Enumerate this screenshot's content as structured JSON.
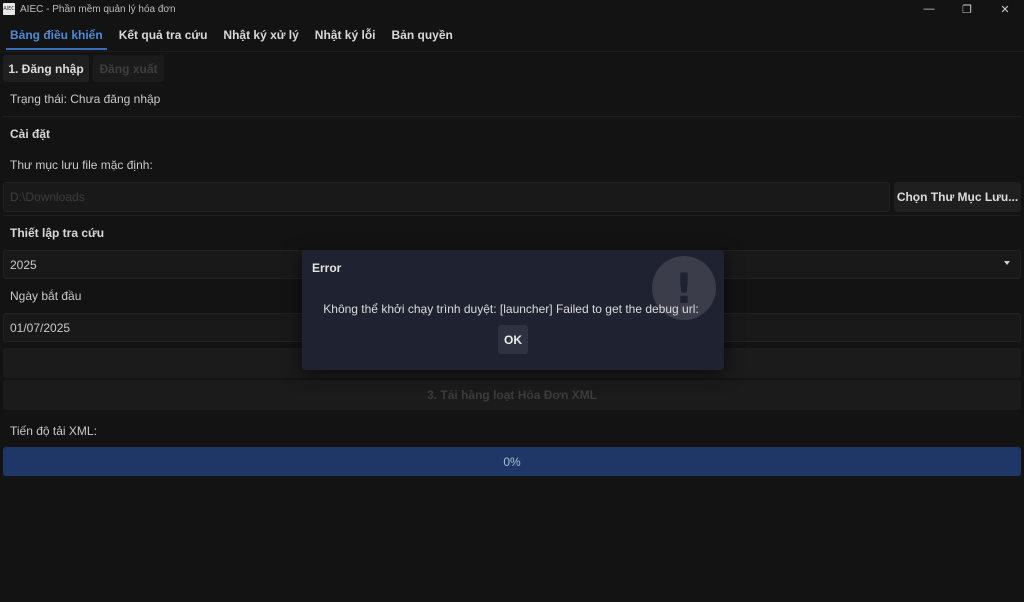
{
  "window": {
    "title": "AIEC - Phần mềm quản lý hóa đơn",
    "icon_label": "AIEC",
    "controls": {
      "minimize": "—",
      "restore": "❐",
      "close": "✕"
    }
  },
  "tabs": [
    {
      "label": "Bảng điều khiển",
      "active": true
    },
    {
      "label": "Kết quả tra cứu"
    },
    {
      "label": "Nhật ký xử lý"
    },
    {
      "label": "Nhật ký lỗi"
    },
    {
      "label": "Bản quyền"
    }
  ],
  "login": {
    "login_button": "1. Đăng nhập",
    "logout_button": "Đăng xuất",
    "status": "Trạng thái: Chưa đăng nhập"
  },
  "settings": {
    "heading": "Cài đặt",
    "folder_label": "Thư mục lưu file mặc định:",
    "folder_placeholder": "D:\\Downloads",
    "choose_folder_button": "Chọn Thư Mục Lưu..."
  },
  "lookup": {
    "heading": "Thiết lập tra cứu",
    "year_value": "2025",
    "start_date_label": "Ngày bắt đầu",
    "start_date_value": "01/07/2025",
    "search_button": "",
    "download_button": "3. Tải hàng loạt Hóa Đơn XML"
  },
  "progress": {
    "label": "Tiến độ tải XML:",
    "value_text": "0%",
    "value": 0
  },
  "dialog": {
    "title": "Error",
    "icon": "!",
    "message": "Không thể khởi chạy trình duyệt: [launcher] Failed to get the debug url:",
    "ok_button": "OK"
  },
  "colors": {
    "accent": "#4c8bd8",
    "progress_fill": "#1f3766",
    "dialog_bg": "#1f2230"
  }
}
